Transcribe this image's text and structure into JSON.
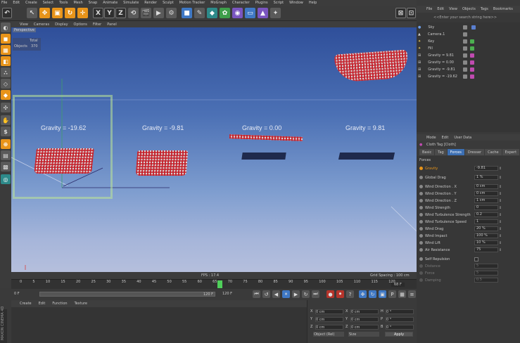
{
  "menubar": [
    "File",
    "Edit",
    "Create",
    "Select",
    "Tools",
    "Mesh",
    "Snap",
    "Animate",
    "Simulate",
    "Render",
    "Sculpt",
    "Motion Tracker",
    "MoGraph",
    "Character",
    "Plugins",
    "Script",
    "Window",
    "Help"
  ],
  "viewport": {
    "menu": [
      "View",
      "Cameras",
      "Display",
      "Options",
      "Filter",
      "Panel"
    ],
    "label": "Perspective",
    "stats_total": "Total",
    "stats_objects_label": "Objects",
    "stats_objects_value": "370",
    "gravity_labels": [
      "Gravity = -19.62",
      "Gravity = -9.81",
      "Gravity = 0.00",
      "Gravity = 9.81"
    ],
    "fps": "FPS : 17.4",
    "grid_spacing": "Grid Spacing : 100 cm"
  },
  "timeline": {
    "ticks": [
      "0",
      "5",
      "10",
      "15",
      "20",
      "25",
      "30",
      "35",
      "40",
      "45",
      "50",
      "55",
      "60",
      "65",
      "70",
      "75",
      "80",
      "85",
      "90",
      "95",
      "100",
      "105",
      "110",
      "115",
      "120"
    ],
    "current_frame": "68 F",
    "start_field": "0 F",
    "end_field": "120 F",
    "end_field2": "120 F",
    "start_field2": "0 F"
  },
  "materials": {
    "menu": [
      "Create",
      "Edit",
      "Function",
      "Texture"
    ]
  },
  "coords": {
    "rows": [
      {
        "a": "X",
        "av": "0 cm",
        "b": "X",
        "bv": "0 cm",
        "c": "H",
        "cv": "0 °"
      },
      {
        "a": "Y",
        "av": "0 cm",
        "b": "Y",
        "bv": "0 cm",
        "c": "P",
        "cv": "0 °"
      },
      {
        "a": "Z",
        "av": "0 cm",
        "b": "Z",
        "bv": "0 cm",
        "c": "B",
        "cv": "0 °"
      }
    ],
    "mode": "Object (Rel)",
    "size_mode": "Size",
    "apply": "Apply"
  },
  "objects": {
    "menu": [
      "File",
      "Edit",
      "View",
      "Objects",
      "Tags",
      "Bookmarks"
    ],
    "search_placeholder": "<<Enter your search string here>>",
    "items": [
      "Sky",
      "Camera.1",
      "Key",
      "Fill",
      "Gravity = 9.81",
      "Gravity = 0.00",
      "Gravity = -9.81",
      "Gravity = -19.62"
    ]
  },
  "attributes": {
    "menu": [
      "Mode",
      "Edit",
      "User Data"
    ],
    "title": "Cloth Tag [Cloth]",
    "tabs": [
      "Basic",
      "Tag",
      "Forces",
      "Dresser",
      "Cache",
      "Expert"
    ],
    "active_tab": "Forces",
    "section": "Forces",
    "rows": [
      {
        "label": "Gravity",
        "value": "-9.81"
      },
      {
        "label": "Global Drag",
        "value": "1 %"
      },
      {
        "label": "Wind Direction . X",
        "value": "0 cm"
      },
      {
        "label": "Wind Direction . Y",
        "value": "0 cm"
      },
      {
        "label": "Wind Direction . Z",
        "value": "1 cm"
      },
      {
        "label": "Wind Strength",
        "value": "0"
      },
      {
        "label": "Wind Turbulence Strength",
        "value": "0.2"
      },
      {
        "label": "Wind Turbulence Speed",
        "value": "1"
      },
      {
        "label": "Wind Drag",
        "value": "20 %"
      },
      {
        "label": "Wind Impact",
        "value": "100 %"
      },
      {
        "label": "Wind Lift",
        "value": "10 %"
      },
      {
        "label": "Air Resistance",
        "value": "75"
      }
    ],
    "self_rep": "Self Repulsion",
    "dim_rows": [
      {
        "label": "Distance",
        "value": "5"
      },
      {
        "label": "Force",
        "value": "5"
      },
      {
        "label": "Damping",
        "value": "0.5"
      }
    ]
  },
  "brand": "MAXON CINEMA 4D"
}
